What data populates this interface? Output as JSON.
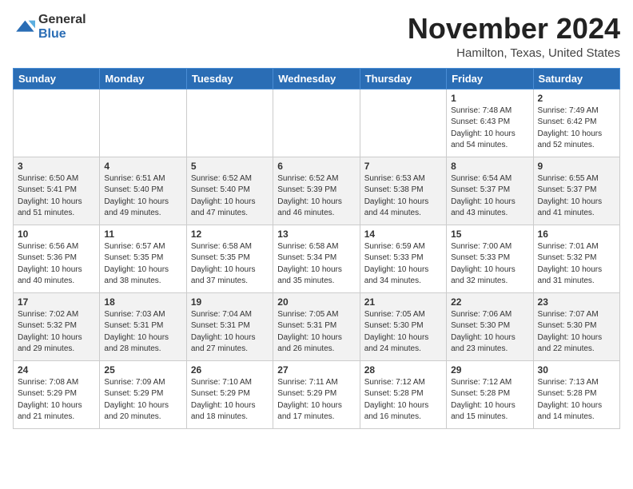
{
  "header": {
    "logo_general": "General",
    "logo_blue": "Blue",
    "month": "November 2024",
    "location": "Hamilton, Texas, United States"
  },
  "days_of_week": [
    "Sunday",
    "Monday",
    "Tuesday",
    "Wednesday",
    "Thursday",
    "Friday",
    "Saturday"
  ],
  "weeks": [
    [
      {
        "day": "",
        "info": ""
      },
      {
        "day": "",
        "info": ""
      },
      {
        "day": "",
        "info": ""
      },
      {
        "day": "",
        "info": ""
      },
      {
        "day": "",
        "info": ""
      },
      {
        "day": "1",
        "info": "Sunrise: 7:48 AM\nSunset: 6:43 PM\nDaylight: 10 hours\nand 54 minutes."
      },
      {
        "day": "2",
        "info": "Sunrise: 7:49 AM\nSunset: 6:42 PM\nDaylight: 10 hours\nand 52 minutes."
      }
    ],
    [
      {
        "day": "3",
        "info": "Sunrise: 6:50 AM\nSunset: 5:41 PM\nDaylight: 10 hours\nand 51 minutes."
      },
      {
        "day": "4",
        "info": "Sunrise: 6:51 AM\nSunset: 5:40 PM\nDaylight: 10 hours\nand 49 minutes."
      },
      {
        "day": "5",
        "info": "Sunrise: 6:52 AM\nSunset: 5:40 PM\nDaylight: 10 hours\nand 47 minutes."
      },
      {
        "day": "6",
        "info": "Sunrise: 6:52 AM\nSunset: 5:39 PM\nDaylight: 10 hours\nand 46 minutes."
      },
      {
        "day": "7",
        "info": "Sunrise: 6:53 AM\nSunset: 5:38 PM\nDaylight: 10 hours\nand 44 minutes."
      },
      {
        "day": "8",
        "info": "Sunrise: 6:54 AM\nSunset: 5:37 PM\nDaylight: 10 hours\nand 43 minutes."
      },
      {
        "day": "9",
        "info": "Sunrise: 6:55 AM\nSunset: 5:37 PM\nDaylight: 10 hours\nand 41 minutes."
      }
    ],
    [
      {
        "day": "10",
        "info": "Sunrise: 6:56 AM\nSunset: 5:36 PM\nDaylight: 10 hours\nand 40 minutes."
      },
      {
        "day": "11",
        "info": "Sunrise: 6:57 AM\nSunset: 5:35 PM\nDaylight: 10 hours\nand 38 minutes."
      },
      {
        "day": "12",
        "info": "Sunrise: 6:58 AM\nSunset: 5:35 PM\nDaylight: 10 hours\nand 37 minutes."
      },
      {
        "day": "13",
        "info": "Sunrise: 6:58 AM\nSunset: 5:34 PM\nDaylight: 10 hours\nand 35 minutes."
      },
      {
        "day": "14",
        "info": "Sunrise: 6:59 AM\nSunset: 5:33 PM\nDaylight: 10 hours\nand 34 minutes."
      },
      {
        "day": "15",
        "info": "Sunrise: 7:00 AM\nSunset: 5:33 PM\nDaylight: 10 hours\nand 32 minutes."
      },
      {
        "day": "16",
        "info": "Sunrise: 7:01 AM\nSunset: 5:32 PM\nDaylight: 10 hours\nand 31 minutes."
      }
    ],
    [
      {
        "day": "17",
        "info": "Sunrise: 7:02 AM\nSunset: 5:32 PM\nDaylight: 10 hours\nand 29 minutes."
      },
      {
        "day": "18",
        "info": "Sunrise: 7:03 AM\nSunset: 5:31 PM\nDaylight: 10 hours\nand 28 minutes."
      },
      {
        "day": "19",
        "info": "Sunrise: 7:04 AM\nSunset: 5:31 PM\nDaylight: 10 hours\nand 27 minutes."
      },
      {
        "day": "20",
        "info": "Sunrise: 7:05 AM\nSunset: 5:31 PM\nDaylight: 10 hours\nand 26 minutes."
      },
      {
        "day": "21",
        "info": "Sunrise: 7:05 AM\nSunset: 5:30 PM\nDaylight: 10 hours\nand 24 minutes."
      },
      {
        "day": "22",
        "info": "Sunrise: 7:06 AM\nSunset: 5:30 PM\nDaylight: 10 hours\nand 23 minutes."
      },
      {
        "day": "23",
        "info": "Sunrise: 7:07 AM\nSunset: 5:30 PM\nDaylight: 10 hours\nand 22 minutes."
      }
    ],
    [
      {
        "day": "24",
        "info": "Sunrise: 7:08 AM\nSunset: 5:29 PM\nDaylight: 10 hours\nand 21 minutes."
      },
      {
        "day": "25",
        "info": "Sunrise: 7:09 AM\nSunset: 5:29 PM\nDaylight: 10 hours\nand 20 minutes."
      },
      {
        "day": "26",
        "info": "Sunrise: 7:10 AM\nSunset: 5:29 PM\nDaylight: 10 hours\nand 18 minutes."
      },
      {
        "day": "27",
        "info": "Sunrise: 7:11 AM\nSunset: 5:29 PM\nDaylight: 10 hours\nand 17 minutes."
      },
      {
        "day": "28",
        "info": "Sunrise: 7:12 AM\nSunset: 5:28 PM\nDaylight: 10 hours\nand 16 minutes."
      },
      {
        "day": "29",
        "info": "Sunrise: 7:12 AM\nSunset: 5:28 PM\nDaylight: 10 hours\nand 15 minutes."
      },
      {
        "day": "30",
        "info": "Sunrise: 7:13 AM\nSunset: 5:28 PM\nDaylight: 10 hours\nand 14 minutes."
      }
    ]
  ]
}
